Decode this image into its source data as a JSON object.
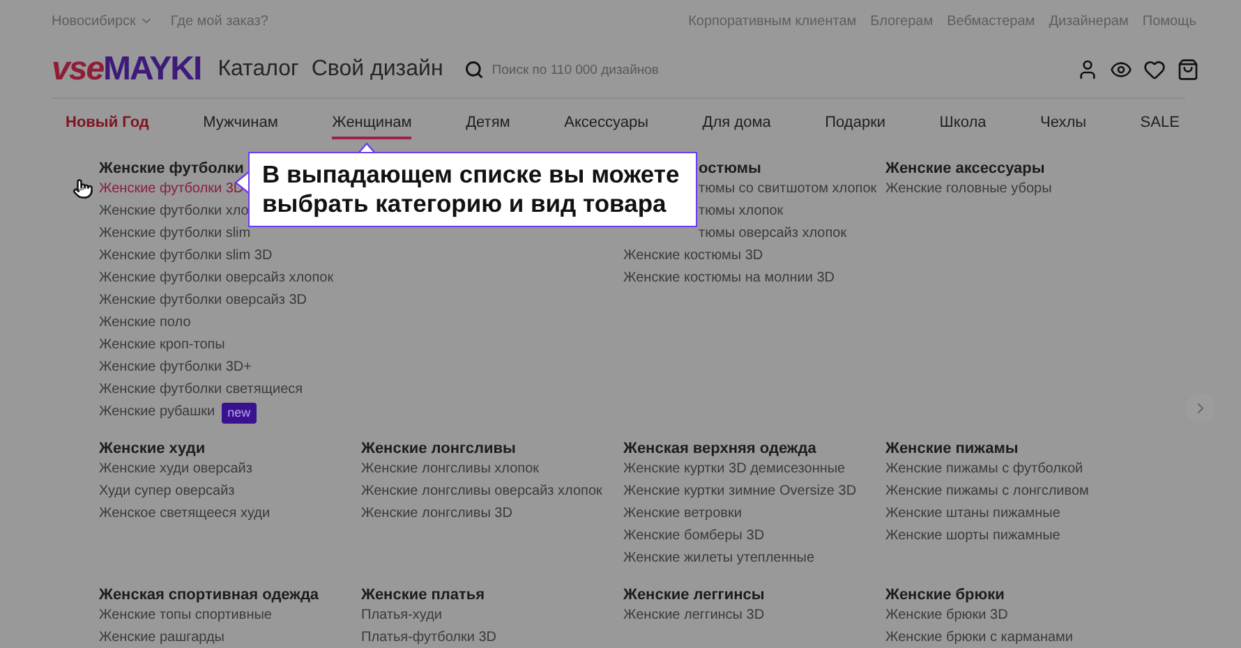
{
  "topbar": {
    "city": "Новосибирск",
    "order_link": "Где мой заказ?",
    "links": [
      "Корпоративным клиентам",
      "Блогерам",
      "Вебмастерам",
      "Дизайнерам",
      "Помощь"
    ]
  },
  "header": {
    "logo": {
      "part1": "vse",
      "part2": "MAYKI"
    },
    "links": [
      "Каталог",
      "Свой дизайн"
    ],
    "search": {
      "placeholder": "Поиск по 110 000 дизайнов"
    }
  },
  "nav": [
    {
      "label": "Новый Год",
      "kind": "highlight",
      "selected": false
    },
    {
      "label": "Мужчинам",
      "kind": "plain",
      "selected": false
    },
    {
      "label": "Женщинам",
      "kind": "plain",
      "selected": true
    },
    {
      "label": "Детям",
      "kind": "plain",
      "selected": false
    },
    {
      "label": "Аксессуары",
      "kind": "plain",
      "selected": false
    },
    {
      "label": "Для дома",
      "kind": "plain",
      "selected": false
    },
    {
      "label": "Подарки",
      "kind": "plain",
      "selected": false
    },
    {
      "label": "Школа",
      "kind": "plain",
      "selected": false
    },
    {
      "label": "Чехлы",
      "kind": "plain",
      "selected": false
    },
    {
      "label": "SALE",
      "kind": "plain",
      "selected": false
    }
  ],
  "menu_rows": [
    {
      "groups": [
        {
          "title": "Женские футболки",
          "items": [
            {
              "label": "Женские футболки 3D",
              "hovered": true
            },
            {
              "label": "Женские футболки хло",
              "hovered": false
            },
            {
              "label": "Женские футболки slim",
              "hovered": false
            },
            {
              "label": "Женские футболки slim 3D",
              "hovered": false
            },
            {
              "label": "Женские футболки оверсайз хлопок",
              "hovered": false
            },
            {
              "label": "Женские футболки оверсайз 3D",
              "hovered": false
            },
            {
              "label": "Женские поло",
              "hovered": false
            },
            {
              "label": "Женские кроп-топы",
              "hovered": false
            },
            {
              "label": "Женские футболки 3D+",
              "hovered": false
            },
            {
              "label": "Женские футболки светящиеся",
              "hovered": false
            },
            {
              "label": "Женские рубашки",
              "hovered": false,
              "badge": "new"
            }
          ]
        },
        {
          "skip_before": true,
          "title_covered": true,
          "title": "остюмы",
          "items": [
            {
              "label": "тюмы со свитшотом хлопок",
              "hovered": false,
              "covered": true
            },
            {
              "label": "тюмы хлопок",
              "hovered": false,
              "covered": true
            },
            {
              "label": "тюмы оверсайз хлопок",
              "hovered": false,
              "covered": true
            },
            {
              "label": "Женские костюмы 3D",
              "hovered": false
            },
            {
              "label": "Женские костюмы на молнии 3D",
              "hovered": false
            }
          ]
        },
        {
          "title": "Женские аксессуары",
          "items": [
            {
              "label": "Женские головные уборы",
              "hovered": false
            }
          ]
        }
      ]
    },
    {
      "groups": [
        {
          "title": "Женские худи",
          "items": [
            {
              "label": "Женские худи оверсайз",
              "hovered": false
            },
            {
              "label": "Худи супер оверсайз",
              "hovered": false
            },
            {
              "label": "Женское светящееся худи",
              "hovered": false
            }
          ]
        },
        {
          "title": "Женские лонгсливы",
          "items": [
            {
              "label": "Женские лонгсливы хлопок",
              "hovered": false
            },
            {
              "label": "Женские лонгсливы оверсайз хлопок",
              "hovered": false
            },
            {
              "label": "Женские лонгсливы 3D",
              "hovered": false
            }
          ]
        },
        {
          "title": "Женская верхняя одежда",
          "items": [
            {
              "label": "Женские куртки 3D демисезонные",
              "hovered": false
            },
            {
              "label": "Женские куртки зимние Oversize 3D",
              "hovered": false
            },
            {
              "label": "Женские ветровки",
              "hovered": false
            },
            {
              "label": "Женские бомберы 3D",
              "hovered": false
            },
            {
              "label": "Женские жилеты утепленные",
              "hovered": false
            }
          ]
        },
        {
          "title": "Женские пижамы",
          "items": [
            {
              "label": "Женские пижамы с футболкой",
              "hovered": false
            },
            {
              "label": "Женские пижамы с лонгсливом",
              "hovered": false
            },
            {
              "label": "Женские штаны пижамные",
              "hovered": false
            },
            {
              "label": "Женские шорты пижамные",
              "hovered": false
            }
          ]
        }
      ]
    },
    {
      "groups": [
        {
          "title": "Женская спортивная одежда",
          "items": [
            {
              "label": "Женские топы спортивные",
              "hovered": false
            },
            {
              "label": "Женские рашгарды",
              "hovered": false
            }
          ]
        },
        {
          "title": "Женские платья",
          "items": [
            {
              "label": "Платья-худи",
              "hovered": false
            },
            {
              "label": "Платья-футболки 3D",
              "hovered": false
            }
          ]
        },
        {
          "title": "Женские леггинсы",
          "items": [
            {
              "label": "Женские леггинсы 3D",
              "hovered": false
            }
          ]
        },
        {
          "title": "Женские брюки",
          "items": [
            {
              "label": "Женские брюки 3D",
              "hovered": false
            },
            {
              "label": "Женские брюки с карманами",
              "hovered": false
            }
          ]
        }
      ]
    }
  ],
  "callout": {
    "text": "В выпадающем списке вы можете выбрать категорию и вид товара"
  }
}
